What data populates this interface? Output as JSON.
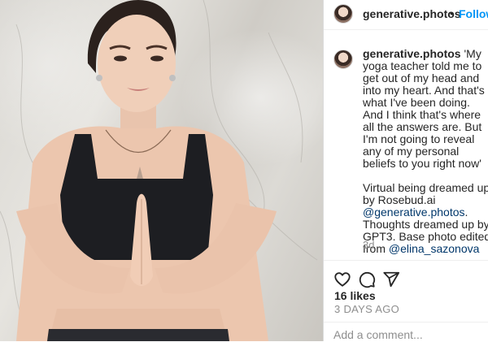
{
  "post": {
    "author": "generative.photos",
    "follow_label": "Follow",
    "separator": "•",
    "caption_username": "generative.photos",
    "caption_lines": [
      "'My",
      "yoga teacher told me to",
      "get out of my head and",
      "into my heart. And that's",
      "what I've been doing.",
      "And I think that's where",
      "all the answers are. But",
      "I'm not going to reveal",
      "any of my personal",
      "beliefs to you right now'",
      "",
      "Virtual being dreamed up",
      "by Rosebud.ai"
    ],
    "mention_1": "@generative.photos",
    "after_mention_1": ".",
    "line_thoughts": "Thoughts dreamed up by",
    "line_gpt3": "GPT3. Base photo edited",
    "from_label": "from ",
    "mention_2": "@elina_sazonova",
    "relative_time": "3d",
    "likes": "16 likes",
    "timestamp": "3 DAYS AGO",
    "comment_placeholder": "Add a comment..."
  },
  "icons": {
    "like": "heart-icon",
    "comment": "comment-icon",
    "share": "paper-plane-icon"
  },
  "colors": {
    "accent": "#0095f6",
    "mention": "#00376b",
    "muted": "#8e8e8e",
    "text": "#262626"
  }
}
